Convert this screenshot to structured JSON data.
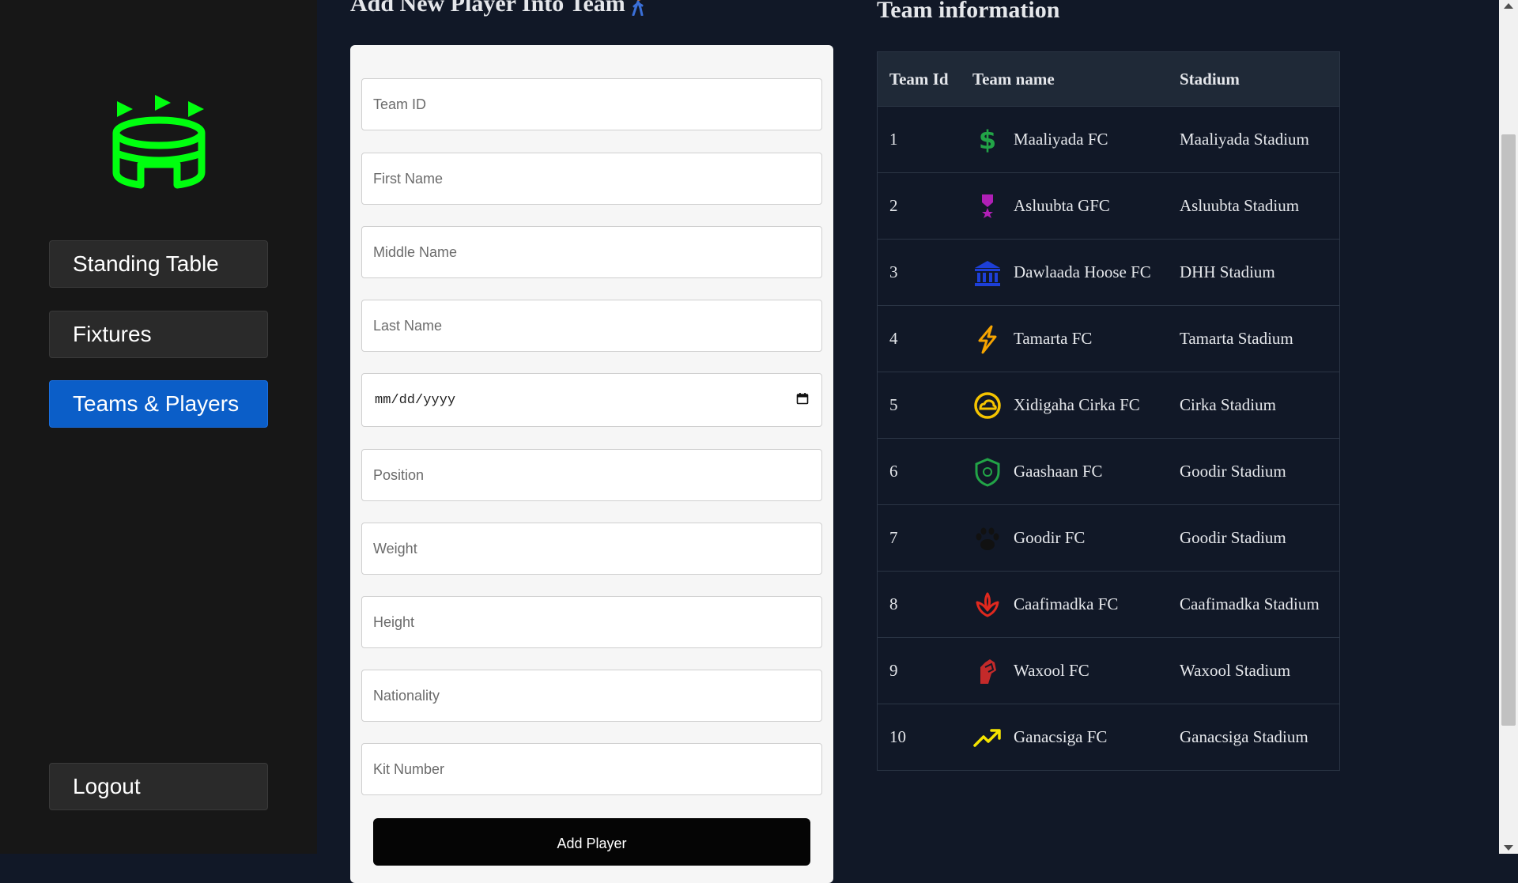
{
  "sidebar": {
    "logo_icon": "stadium-icon",
    "brand_color": "#00ff0f",
    "nav": [
      {
        "label": "Standing Table"
      },
      {
        "label": "Fixtures"
      },
      {
        "label": "Teams & Players",
        "active": true
      }
    ],
    "logout_label": "Logout"
  },
  "form": {
    "title": "Add New Player Into Team",
    "title_icon": "person-walking-icon",
    "placeholders": {
      "team_id": "Team ID",
      "first_name": "First Name",
      "middle_name": "Middle Name",
      "last_name": "Last Name",
      "position": "Position",
      "weight": "Weight",
      "height": "Height",
      "nationality": "Nationality",
      "kit_number": "Kit Number"
    },
    "date_placeholder": "mm/dd/yyyy",
    "submit_label": "Add Player"
  },
  "teams": {
    "title": "Team information",
    "headers": {
      "id": "Team Id",
      "name": "Team name",
      "stadium": "Stadium"
    },
    "rows": [
      {
        "id": "1",
        "name": "Maaliyada FC",
        "stadium": "Maaliyada Stadium",
        "icon": "dollar-icon",
        "color": "#22a447"
      },
      {
        "id": "2",
        "name": "Asluubta GFC",
        "stadium": "Asluubta Stadium",
        "icon": "medal-icon",
        "color": "#b01fb6"
      },
      {
        "id": "3",
        "name": "Dawlaada Hoose FC",
        "stadium": "DHH Stadium",
        "icon": "bank-icon",
        "color": "#1d3fd8"
      },
      {
        "id": "4",
        "name": "Tamarta FC",
        "stadium": "Tamarta Stadium",
        "icon": "lightning-icon",
        "color": "#f5a300"
      },
      {
        "id": "5",
        "name": "Xidigaha Cirka FC",
        "stadium": "Cirka Stadium",
        "icon": "cloud-circle-icon",
        "color": "#f5c400"
      },
      {
        "id": "6",
        "name": "Gaashaan FC",
        "stadium": "Goodir Stadium",
        "icon": "shield-icon",
        "color": "#22a447"
      },
      {
        "id": "7",
        "name": "Goodir FC",
        "stadium": "Goodir Stadium",
        "icon": "paw-icon",
        "color": "#111111"
      },
      {
        "id": "8",
        "name": "Caafimadka FC",
        "stadium": "Caafimadka Stadium",
        "icon": "lotus-icon",
        "color": "#e0281e"
      },
      {
        "id": "9",
        "name": "Waxool FC",
        "stadium": "Waxool Stadium",
        "icon": "hand-icon",
        "color": "#c42a2a"
      },
      {
        "id": "10",
        "name": "Ganacsiga FC",
        "stadium": "Ganacsiga Stadium",
        "icon": "trending-up-icon",
        "color": "#f5e400"
      }
    ]
  }
}
